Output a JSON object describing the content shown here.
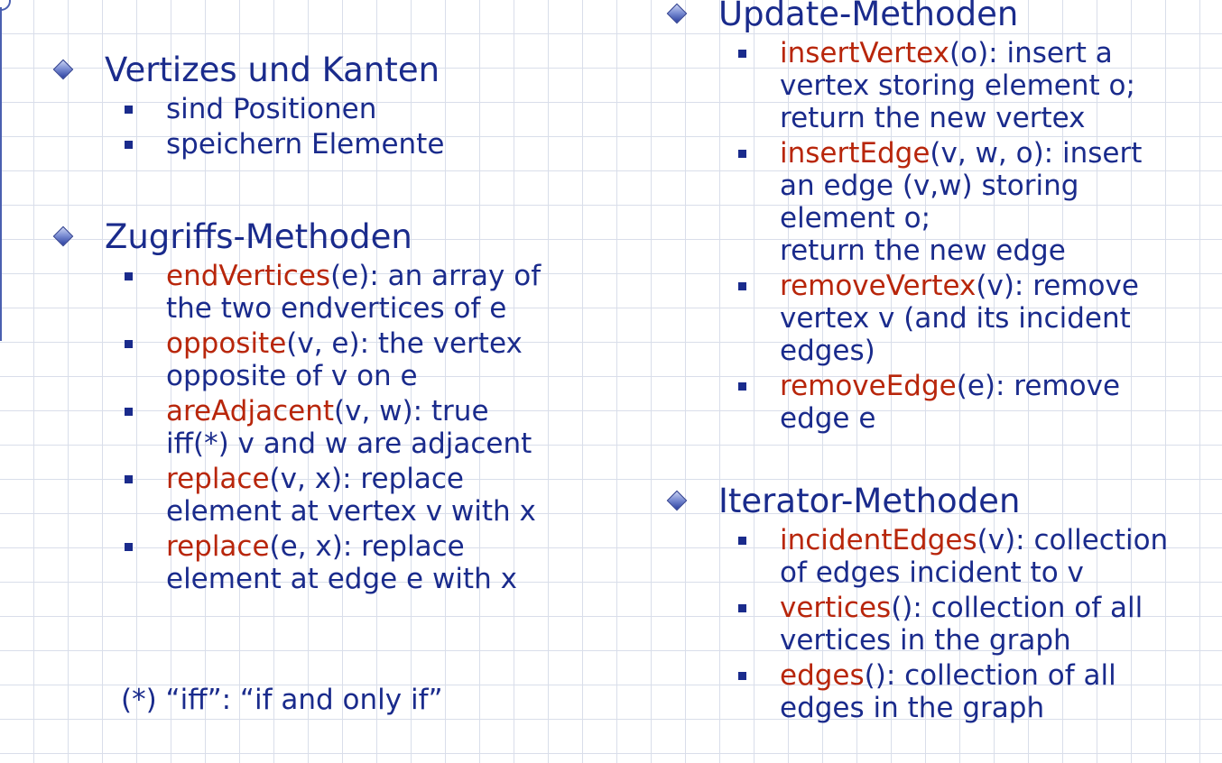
{
  "left": {
    "vertices_heading": "Vertizes und Kanten",
    "vertices_items": [
      "sind Positionen",
      "speichern Elemente"
    ],
    "access_heading": "Zugriffs-Methoden",
    "access_items": [
      {
        "name": "endVertices",
        "lines": [
          "(e): an array of",
          "the two endvertices of e"
        ]
      },
      {
        "name": "opposite",
        "lines": [
          "(v, e): the vertex",
          "opposite of v on e"
        ]
      },
      {
        "name": "areAdjacent",
        "lines": [
          "(v, w): true",
          "iff(*) v and w are adjacent"
        ]
      },
      {
        "name": "replace",
        "lines": [
          "(v, x): replace",
          "element at vertex v with x"
        ]
      },
      {
        "name": "replace",
        "lines": [
          "(e, x): replace",
          "element at edge e with x"
        ]
      }
    ],
    "footnote": "(*) “iff”: “if and only if”"
  },
  "right": {
    "update_heading": "Update-Methoden",
    "update_items": [
      {
        "name": "insertVertex",
        "lines": [
          "(o): insert a",
          "vertex storing element o;",
          "return the new vertex"
        ]
      },
      {
        "name": "insertEdge",
        "lines": [
          "(v, w, o): insert",
          "an edge (v,w) storing",
          "element o;",
          "return the new edge"
        ]
      },
      {
        "name": "removeVertex",
        "lines": [
          "(v): remove",
          "vertex v (and its incident",
          "edges)"
        ]
      },
      {
        "name": "removeEdge",
        "lines": [
          "(e): remove",
          "edge e"
        ]
      }
    ],
    "iterator_heading": "Iterator-Methoden",
    "iterator_items": [
      {
        "name": "incidentEdges",
        "lines": [
          "(v): collection",
          "of edges incident to v"
        ]
      },
      {
        "name": "vertices",
        "lines": [
          "(): collection of all",
          "vertices in the graph"
        ]
      },
      {
        "name": "edges",
        "lines": [
          "(): collection of all",
          "edges in the graph"
        ]
      }
    ]
  },
  "colors": {
    "text": "#1a2b8c",
    "keyword": "#b8260b",
    "grid": "#d9deea"
  }
}
